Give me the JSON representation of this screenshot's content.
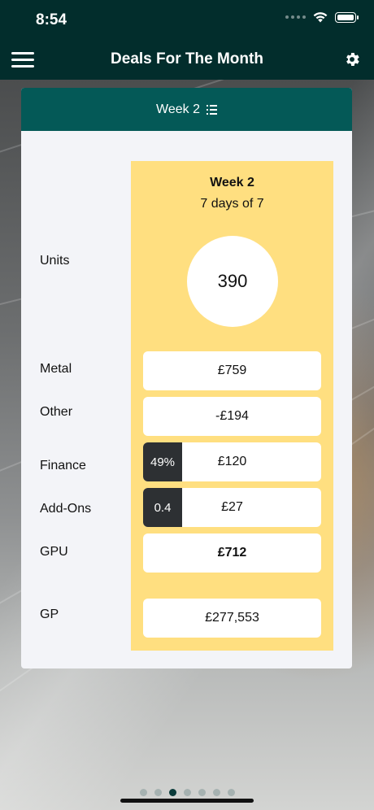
{
  "status_bar": {
    "time": "8:54"
  },
  "header": {
    "title": "Deals For The Month"
  },
  "card": {
    "header_label": "Week 2",
    "labels": {
      "units": "Units",
      "metal": "Metal",
      "other": "Other",
      "finance": "Finance",
      "addons": "Add-Ons",
      "gpu": "GPU",
      "gp": "GP"
    },
    "week": {
      "title": "Week 2",
      "subtitle": "7 days of 7",
      "units": "390",
      "metal": "£759",
      "other": "-£194",
      "finance_badge": "49%",
      "finance": "£120",
      "addons_badge": "0.4",
      "addons": "£27",
      "gpu": "£712",
      "gp": "£277,553"
    }
  },
  "pager": {
    "count": 7,
    "active_index": 2
  },
  "colors": {
    "header_bg": "#022d2c",
    "card_header_bg": "#045957",
    "week_column_bg": "#ffdf80",
    "badge_bg": "#2d3033"
  },
  "icons": [
    "hamburger-menu-icon",
    "gear-icon",
    "list-icon",
    "wifi-icon",
    "battery-icon",
    "signal-icon"
  ]
}
